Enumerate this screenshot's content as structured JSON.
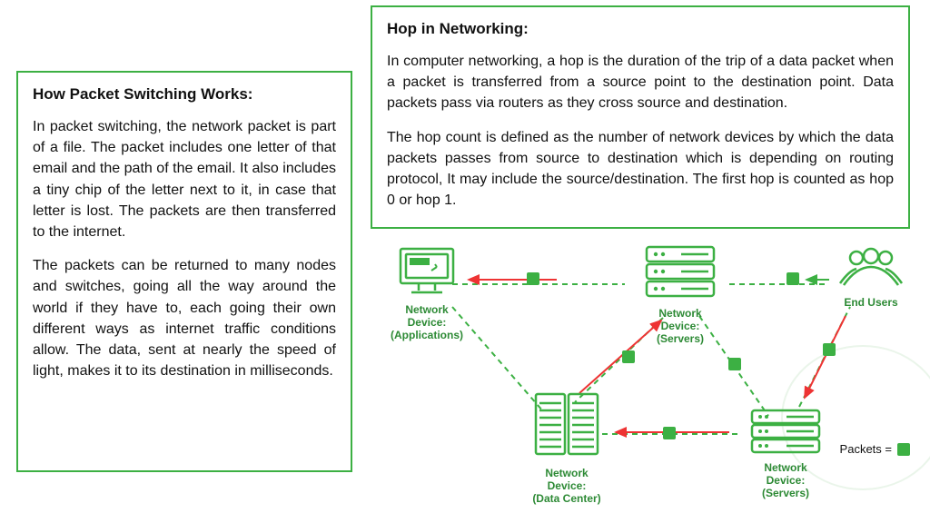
{
  "left_box": {
    "title": "How Packet Switching Works:",
    "p1": "In packet switching, the network packet is part of a file. The packet includes one letter of that email and the path of the email. It also includes a tiny chip of the letter next to it, in case that letter is lost. The packets are then transferred to the internet.",
    "p2": "The packets can be returned to many nodes and switches, going all the way around the world if they have to, each going their own different ways as internet traffic conditions allow. The data, sent at nearly the speed of light, makes it to its destination in milliseconds."
  },
  "right_box": {
    "title": "Hop in Networking:",
    "p1": "In computer networking, a hop is the duration of the trip of a data packet when a packet is transferred from a source point to the destination point. Data packets pass via routers as they cross source and destination.",
    "p2": "The hop count is defined as the number of network devices by which the data packets passes from source to destination which is depending on routing protocol, It may include the source/destination. The first hop is counted as hop 0 or hop 1."
  },
  "diagram": {
    "labels": {
      "applications": "Network\nDevice:\n(Applications)",
      "servers_top": "Network\nDevice:\n(Servers)",
      "data_center": "Network\nDevice:\n(Data Center)",
      "servers_right": "Network\nDevice:\n(Servers)",
      "end_users": "End Users"
    },
    "legend": "Packets ="
  }
}
